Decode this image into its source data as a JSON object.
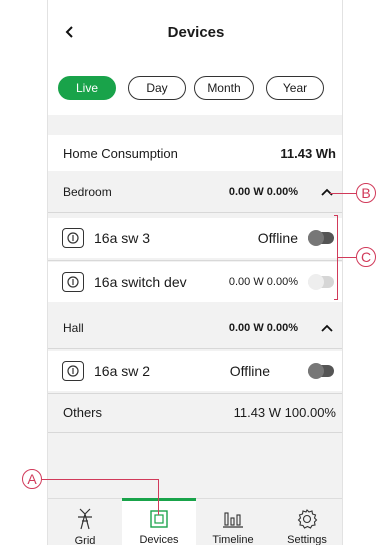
{
  "header": {
    "title": "Devices",
    "back_icon": "chevron-left-icon"
  },
  "filters": {
    "selected": "Live",
    "options": [
      "Live",
      "Day",
      "Month",
      "Year"
    ]
  },
  "home_consumption": {
    "label": "Home Consumption",
    "value": "11.43 Wh"
  },
  "rooms": [
    {
      "name": "Bedroom",
      "power": "0.00 W",
      "percent": "0.00%",
      "expanded": true,
      "devices": [
        {
          "name": "16a sw 3",
          "status": "Offline",
          "toggle_on": false
        },
        {
          "name": "16a switch dev",
          "power": "0.00 W",
          "percent": "0.00%",
          "toggle_on": false
        }
      ]
    },
    {
      "name": "Hall",
      "power": "0.00 W",
      "percent": "0.00%",
      "expanded": true,
      "devices": [
        {
          "name": "16a sw 2",
          "status": "Offline",
          "toggle_on": false
        }
      ]
    }
  ],
  "others": {
    "label": "Others",
    "power": "11.43 W",
    "percent": "100.00%"
  },
  "tabs": [
    {
      "label": "Grid",
      "icon": "grid-tower-icon",
      "active": false
    },
    {
      "label": "Devices",
      "icon": "devices-icon",
      "active": true
    },
    {
      "label": "Timeline",
      "icon": "timeline-bars-icon",
      "active": false
    },
    {
      "label": "Settings",
      "icon": "gear-icon",
      "active": false
    }
  ],
  "callouts": [
    "A",
    "B",
    "C"
  ],
  "colors": {
    "accent": "#19a34a",
    "callout": "#d13a5a"
  }
}
